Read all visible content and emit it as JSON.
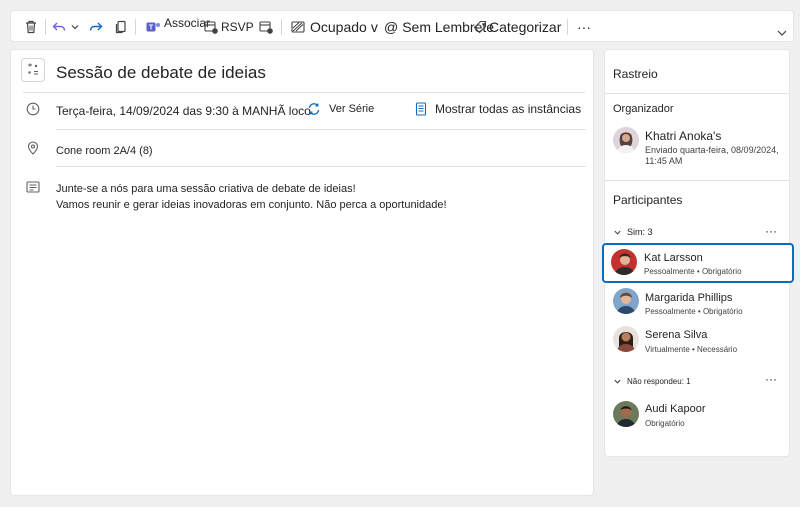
{
  "toolbar": {
    "associate_label": "Associar",
    "rsvp_label": "RSVP",
    "busy_label": "Ocupado",
    "busy_chevron": "v",
    "reminder_label": "Sem Lembrete",
    "reminder_prefix": "@",
    "categorize_label": "Categorizar",
    "more_label": "···"
  },
  "event": {
    "title": "Sessão de debate de ideias",
    "datetime": "Terça-feira, 14/09/2024 das 9:30 à MANHÃ loco",
    "view_series": "Ver Série",
    "show_all": "Mostrar todas as instâncias",
    "location": "Cone room 2A/4 (8)",
    "body_line1": "Junte-se a nós para uma sessão criativa de debate de ideias!",
    "body_line2": "Vamos reunir e gerar ideias inovadoras em conjunto. Não perca a oportunidade!"
  },
  "tracking": {
    "title": "Rastreio",
    "organizer_heading": "Organizador",
    "organizer_name": "Khatri Anoka's",
    "organizer_sent": "Enviado quarta-feira, 08/09/2024,",
    "organizer_time": "11:45 AM",
    "attendees_heading": "Participantes",
    "yes_group": "Sim: 3",
    "noresponse_group": "Não respondeu: 1",
    "more_label": "···",
    "attendees_yes": [
      {
        "name": "Kat Larsson",
        "detail": "Pessoalmente • Obrigatório"
      },
      {
        "name": "Margarida Phillips",
        "detail": "Pessoalmente • Obrigatório"
      },
      {
        "name": "Serena Silva",
        "detail": "Virtualmente • Necessário"
      }
    ],
    "attendees_noresponse": [
      {
        "name": "Audi Kapoor",
        "detail": "Obrigatório"
      }
    ]
  },
  "colors": {
    "accent": "#0f6cbd",
    "teams_purple": "#5b5fc7",
    "reply_purple": "#7160e8"
  }
}
